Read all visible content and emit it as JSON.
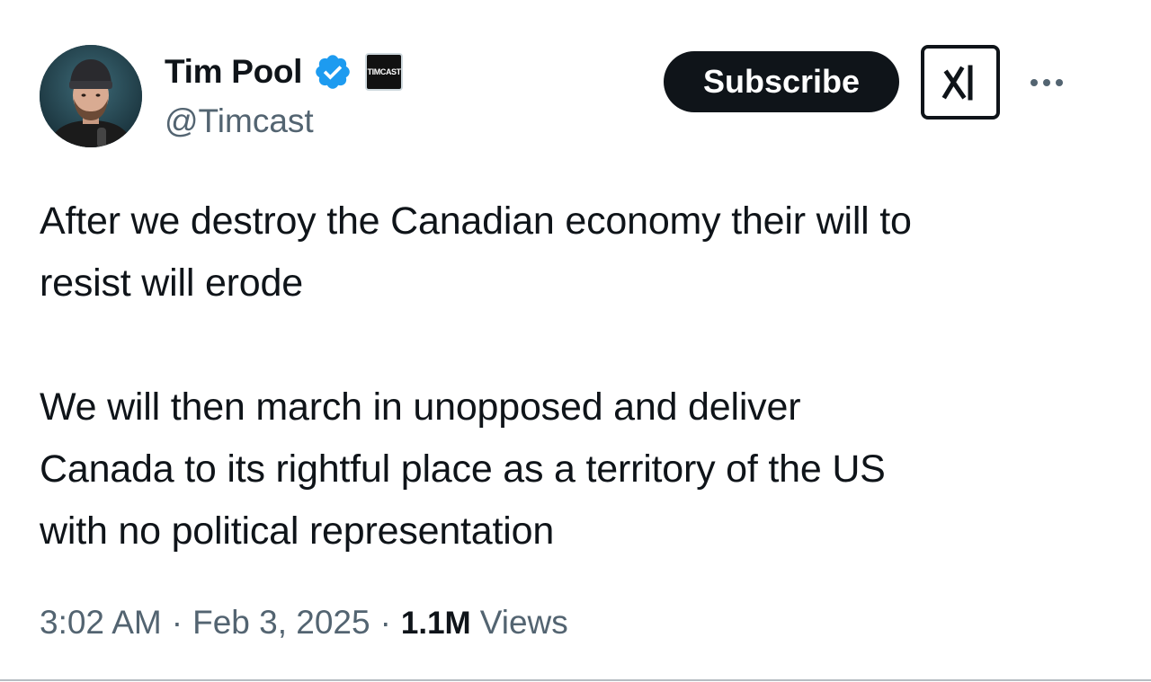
{
  "author": {
    "display_name": "Tim Pool",
    "handle": "@Timcast",
    "verified_icon": "verified-badge-icon",
    "affiliate_badge_text": "TIMCAST"
  },
  "actions": {
    "subscribe_label": "Subscribe",
    "grok_icon": "grok-icon",
    "more_icon": "more-options-icon"
  },
  "tweet": {
    "paragraphs": [
      "After we destroy the Canadian economy their will to\nresist will erode",
      "We will then march in unopposed and  deliver\nCanada to its rightful place as a territory of the US\nwith no political representation"
    ]
  },
  "meta": {
    "time": "3:02 AM",
    "date": "Feb 3, 2025",
    "views_count": "1.1M",
    "views_label": "Views",
    "separator": "·"
  },
  "colors": {
    "text": "#0f1419",
    "secondary": "#536471",
    "verified_blue": "#1d9bf0",
    "button_bg": "#0f1419"
  }
}
